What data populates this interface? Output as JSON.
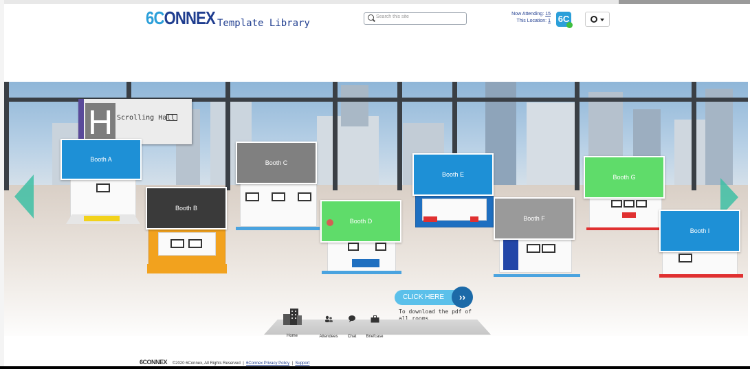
{
  "header": {
    "logo_six": "6C",
    "logo_rest": "ONNEX",
    "title": "Template Library",
    "search_placeholder": "Search this site",
    "now_attending_label": "Now Attending:",
    "now_attending_count": "15",
    "this_location_label": "This Location:",
    "this_location_count": "1",
    "badge_label": "6C"
  },
  "hall": {
    "letter": "H",
    "name": "Scrolling Hall"
  },
  "booths": [
    {
      "label": "Booth A",
      "color": "#1e90d6"
    },
    {
      "label": "Booth B",
      "color": "#3a3a3a"
    },
    {
      "label": "Booth C",
      "color": "#808080"
    },
    {
      "label": "Booth D",
      "color": "#5fdc6a"
    },
    {
      "label": "Booth E",
      "color": "#1e90d6"
    },
    {
      "label": "Booth F",
      "color": "#9a9a9a"
    },
    {
      "label": "Booth G",
      "color": "#5fdc6a"
    },
    {
      "label": "Booth I",
      "color": "#1e90d6"
    }
  ],
  "cta": {
    "label": "CLICK HERE",
    "subtext": "To download the pdf of all rooms"
  },
  "nav": {
    "home": "Home",
    "attendees": "Attendees",
    "chat": "Chat",
    "briefcase": "Briefcase"
  },
  "footer": {
    "logo": "6CONNEX",
    "copyright": "©2020 6Connex, All Rights Reserved",
    "privacy": "6Connex Privacy Policy",
    "support": "Support",
    "sep": "|"
  }
}
